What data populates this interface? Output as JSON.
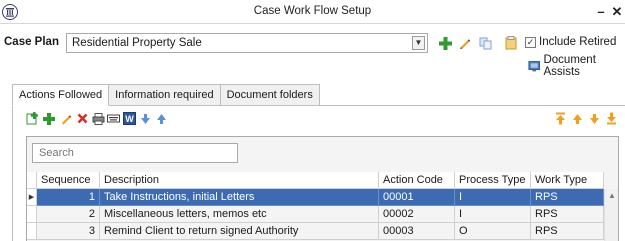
{
  "window": {
    "title": "Case Work Flow Setup",
    "minimize_glyph": "–",
    "close_glyph": "✕"
  },
  "case_plan": {
    "label": "Case Plan",
    "selected": "Residential Property Sale"
  },
  "toolbar_icons": [
    "add-icon",
    "edit-icon",
    "copy-icon",
    "clipboard-icon"
  ],
  "include_retired": {
    "label": "Include Retired",
    "checked": true
  },
  "document_assists": {
    "label": "Document Assists"
  },
  "tabs": [
    {
      "label": "Actions Followed",
      "active": true
    },
    {
      "label": "Information required",
      "active": false
    },
    {
      "label": "Document folders",
      "active": false
    }
  ],
  "panel_toolbar_left": [
    "insert-icon",
    "add-icon",
    "edit-icon",
    "delete-icon",
    "print-icon",
    "keyboard-icon",
    "word-icon",
    "move-down-icon",
    "move-up-icon"
  ],
  "panel_toolbar_right": [
    "move-top-icon",
    "move-up-arrow-icon",
    "move-down-arrow-icon",
    "move-bottom-icon"
  ],
  "search": {
    "placeholder": "Search",
    "value": ""
  },
  "grid": {
    "columns": [
      "Sequence",
      "Description",
      "Action Code",
      "Process Type",
      "Work Type"
    ],
    "rows": [
      {
        "seq": "1",
        "desc": "Take Instructions, initial Letters",
        "code": "00001",
        "ptype": "I",
        "wtype": "RPS",
        "selected": true
      },
      {
        "seq": "2",
        "desc": "Miscellaneous letters, memos etc",
        "code": "00002",
        "ptype": "I",
        "wtype": "RPS",
        "selected": false
      },
      {
        "seq": "3",
        "desc": "Remind Client to return signed Authority",
        "code": "00003",
        "ptype": "O",
        "wtype": "RPS",
        "selected": false
      }
    ]
  },
  "colors": {
    "selection": "#3d6bb3",
    "green_add": "#2e9b2e",
    "orange_arrow": "#f0a020",
    "blue_arrow": "#5b8fd6"
  }
}
